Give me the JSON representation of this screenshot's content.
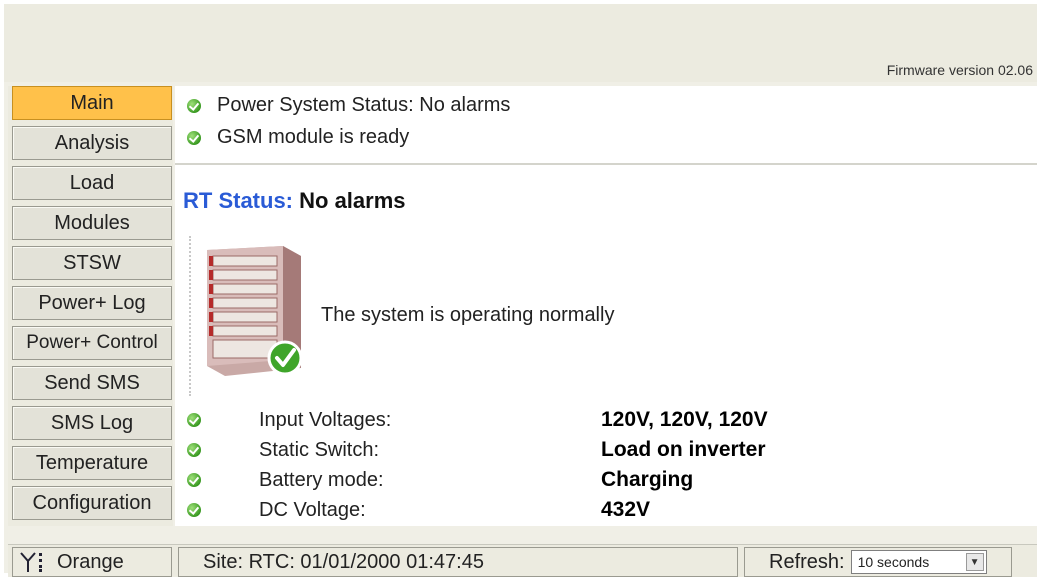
{
  "header": {
    "firmware": "Firmware version 02.06"
  },
  "sidebar": {
    "items": [
      {
        "label": "Main",
        "active": true
      },
      {
        "label": "Analysis"
      },
      {
        "label": "Load"
      },
      {
        "label": "Modules"
      },
      {
        "label": "STSW"
      },
      {
        "label": "Power+ Log"
      },
      {
        "label": "Power+ Control"
      },
      {
        "label": "Send SMS"
      },
      {
        "label": "SMS Log"
      },
      {
        "label": "Temperature"
      },
      {
        "label": "Configuration"
      }
    ]
  },
  "main": {
    "alerts": [
      {
        "text": "Power System Status: No alarms",
        "icon": "ok-check-icon"
      },
      {
        "text": "GSM module is ready",
        "icon": "ok-check-icon"
      }
    ],
    "rt_status": {
      "label": "RT Status:",
      "value": "No alarms"
    },
    "system_message": "The system is operating normally",
    "details": [
      {
        "label": "Input Voltages:",
        "value": "120V, 120V, 120V"
      },
      {
        "label": "Static Switch:",
        "value": "Load on inverter"
      },
      {
        "label": "Battery mode:",
        "value": "Charging"
      },
      {
        "label": "DC Voltage:",
        "value": "432V"
      }
    ]
  },
  "statusbar": {
    "signal_icon": "antenna-signal-icon",
    "operator": "Orange",
    "site_rtc": "Site: RTC: 01/01/2000 01:47:45",
    "refresh_label": "Refresh:",
    "refresh_value": "10 seconds"
  },
  "colors": {
    "active_tab": "#ffc14a",
    "rt_label": "#2a5bd6",
    "ok_green": "#3a9a22",
    "panel_bg": "#ecebe0"
  }
}
